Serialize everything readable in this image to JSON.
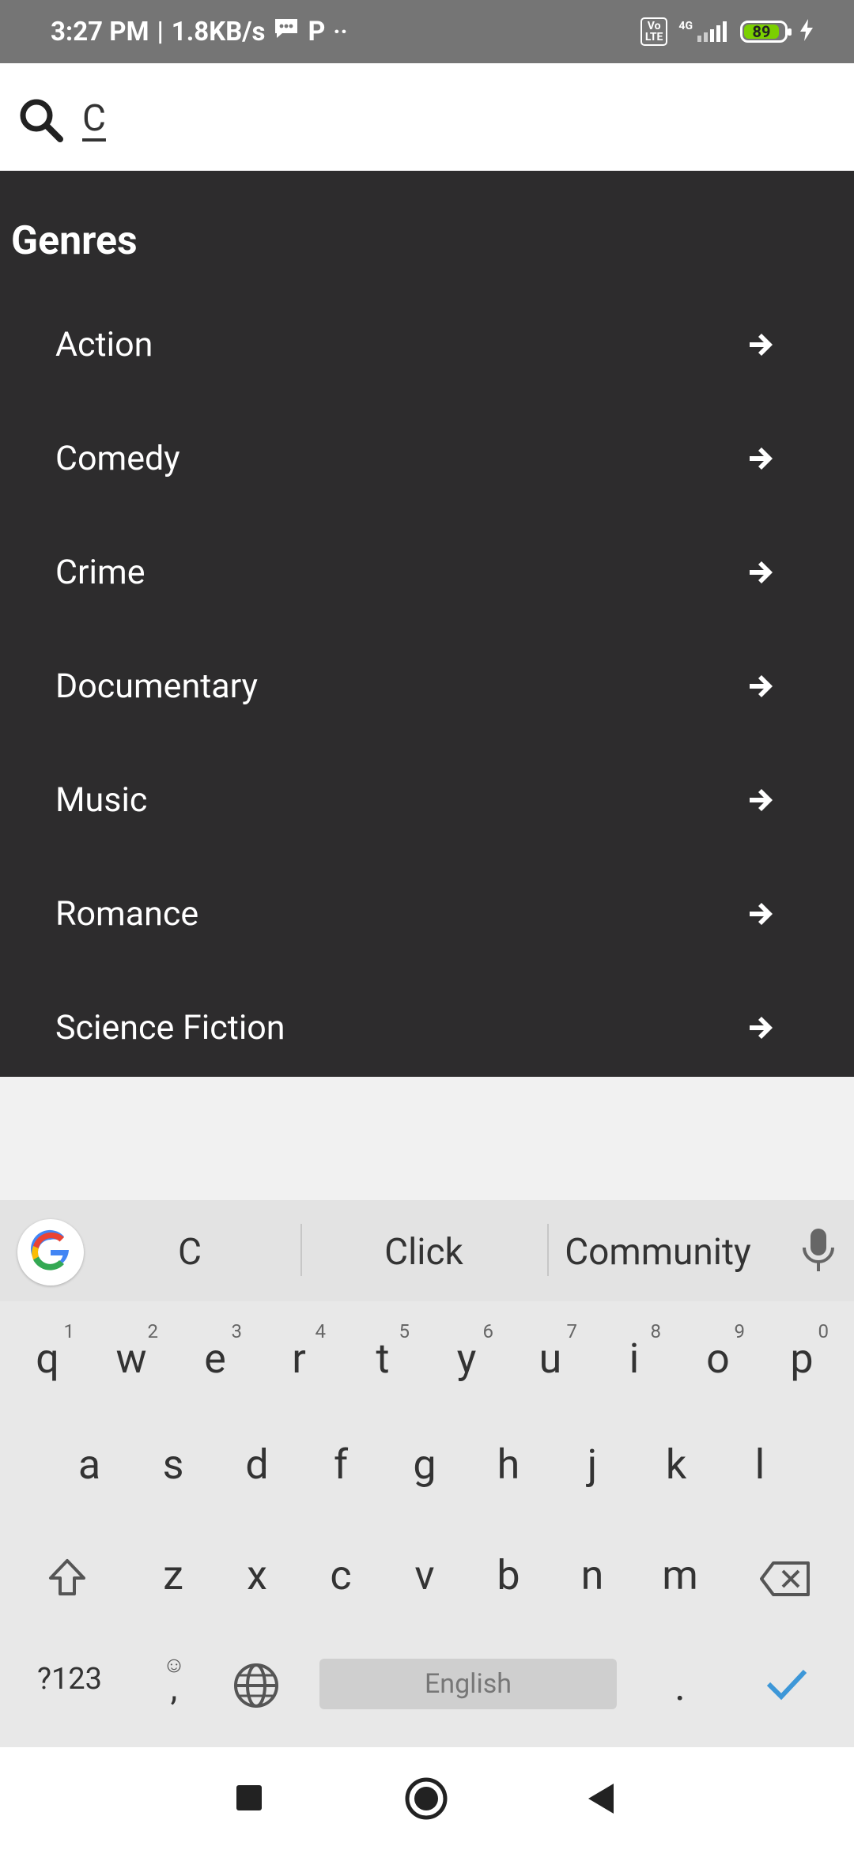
{
  "status_bar": {
    "time": "3:27 PM",
    "speed": "1.8KB/s",
    "p_icon": "P",
    "more_dots": "··",
    "volte": "Vo LTE",
    "network": "4G",
    "battery": "89"
  },
  "search": {
    "value": "C"
  },
  "genres": {
    "title": "Genres",
    "items": [
      {
        "label": "Action"
      },
      {
        "label": "Comedy"
      },
      {
        "label": "Crime"
      },
      {
        "label": "Documentary"
      },
      {
        "label": "Music"
      },
      {
        "label": "Romance"
      },
      {
        "label": "Science Fiction"
      }
    ]
  },
  "keyboard": {
    "suggestions": [
      "C",
      "Click",
      "Community"
    ],
    "row1": [
      {
        "key": "q",
        "num": "1"
      },
      {
        "key": "w",
        "num": "2"
      },
      {
        "key": "e",
        "num": "3"
      },
      {
        "key": "r",
        "num": "4"
      },
      {
        "key": "t",
        "num": "5"
      },
      {
        "key": "y",
        "num": "6"
      },
      {
        "key": "u",
        "num": "7"
      },
      {
        "key": "i",
        "num": "8"
      },
      {
        "key": "o",
        "num": "9"
      },
      {
        "key": "p",
        "num": "0"
      }
    ],
    "row2": [
      "a",
      "s",
      "d",
      "f",
      "g",
      "h",
      "j",
      "k",
      "l"
    ],
    "row3": [
      "z",
      "x",
      "c",
      "v",
      "b",
      "n",
      "m"
    ],
    "symbols_key": "?123",
    "comma_key": ",",
    "period_key": ".",
    "space_label": "English"
  },
  "colors": {
    "status_bar_bg": "#757575",
    "panel_bg": "#2d2c2d",
    "accent_check": "#3d97d8",
    "battery_green": "#7bd000"
  }
}
